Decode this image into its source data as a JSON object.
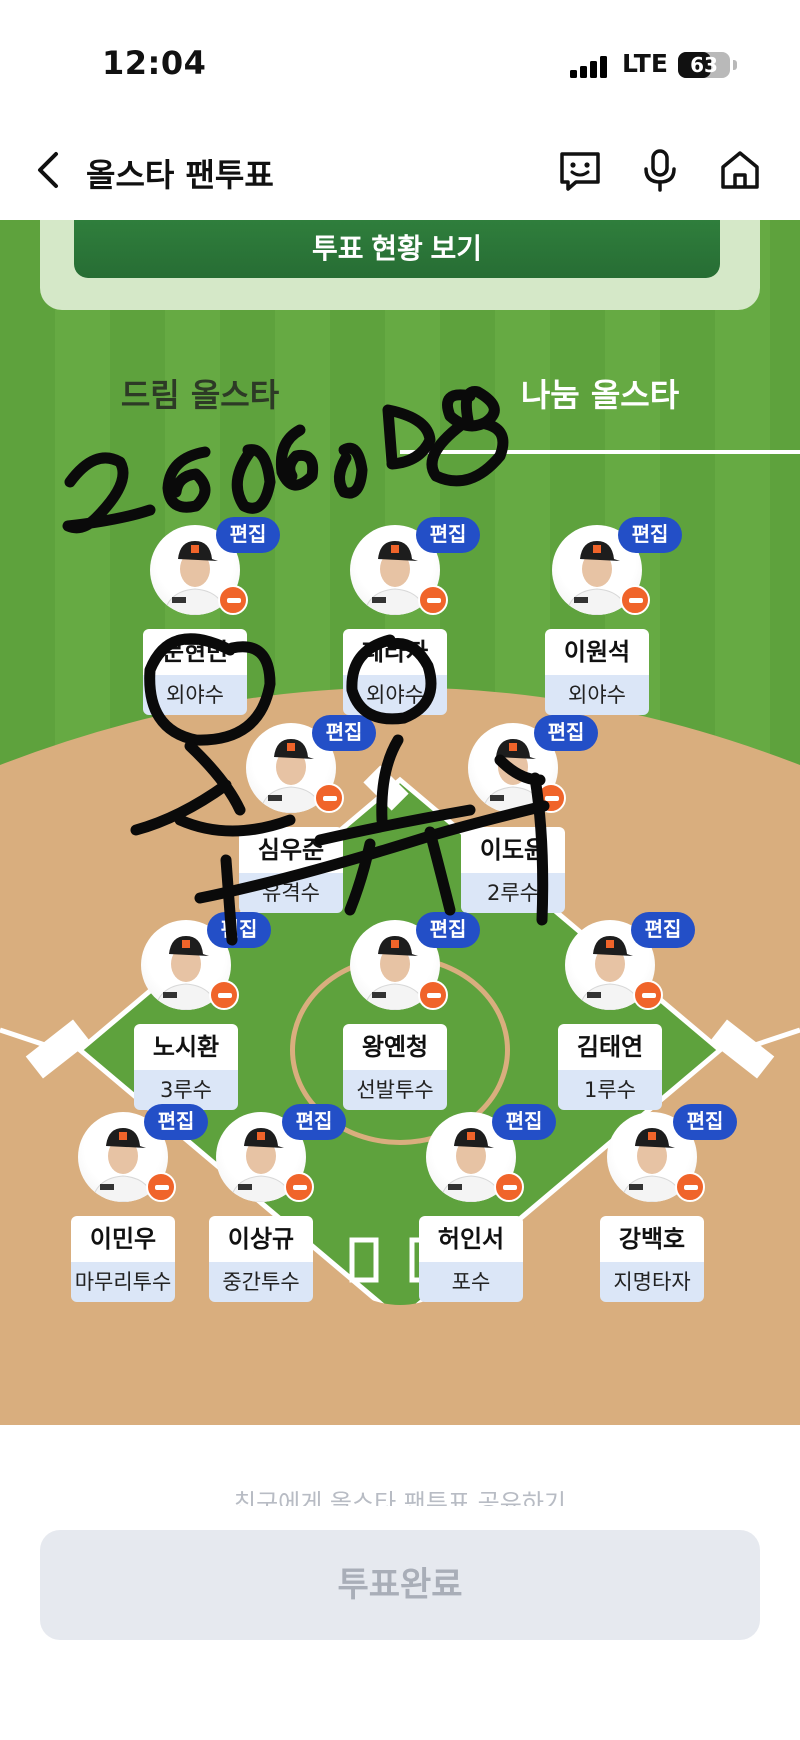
{
  "status_bar": {
    "time": "12:04",
    "network": "LTE",
    "battery": "63",
    "battery_level": 0.63
  },
  "header": {
    "title": "올스타 팬투표"
  },
  "vote_status_button": "투표 현황 보기",
  "tabs": [
    {
      "label": "드림 올스타",
      "selected": false
    },
    {
      "label": "나눔 올스타",
      "selected": true
    }
  ],
  "edit_label": "편집",
  "players": [
    {
      "name": "문현빈",
      "position": "외야수"
    },
    {
      "name": "페라자",
      "position": "외야수"
    },
    {
      "name": "이원석",
      "position": "외야수"
    },
    {
      "name": "심우준",
      "position": "유격수"
    },
    {
      "name": "이도윤",
      "position": "2루수"
    },
    {
      "name": "노시환",
      "position": "3루수"
    },
    {
      "name": "왕옌청",
      "position": "선발투수"
    },
    {
      "name": "김태연",
      "position": "1루수"
    },
    {
      "name": "이민우",
      "position": "마무리투수"
    },
    {
      "name": "이상규",
      "position": "중간투수"
    },
    {
      "name": "허인서",
      "position": "포수"
    },
    {
      "name": "강백호",
      "position": "지명타자"
    }
  ],
  "handwritten_note": "260608 오유",
  "share_text": "친구에게 올스타 팬투표 공유하기",
  "submit_button": "투표완료",
  "colors": {
    "edit_badge": "#234fc7",
    "position_bg": "#dbe6f7",
    "team_badge": "#f0642a",
    "field_green": "#5ea23d"
  }
}
